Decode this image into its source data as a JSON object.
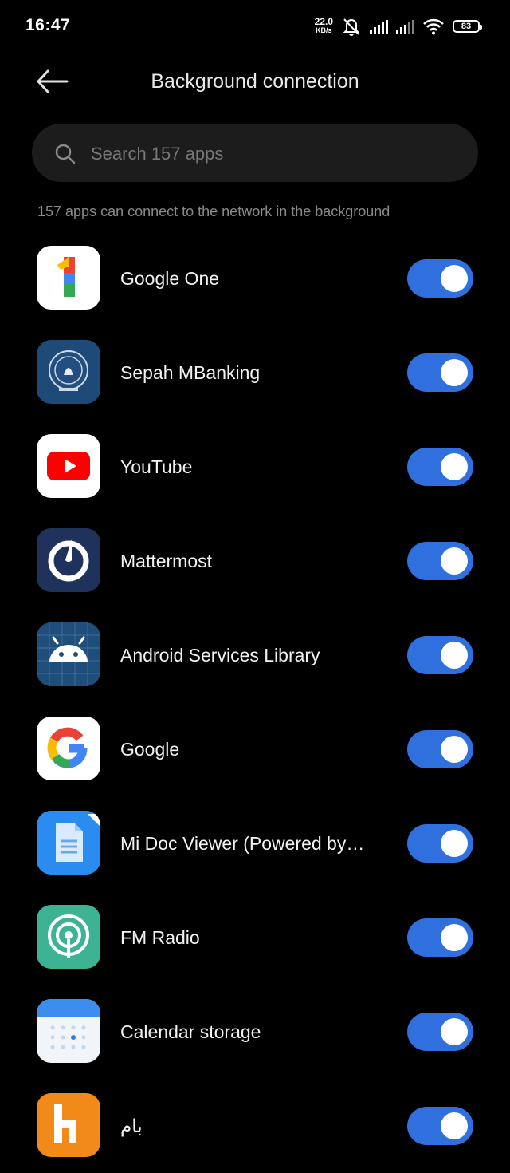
{
  "status_bar": {
    "time": "16:47",
    "net_speed_value": "22.0",
    "net_speed_unit": "KB/s",
    "battery": "83",
    "icons": [
      "mute-bell-icon",
      "signal-icon",
      "signal-icon",
      "wifi-icon",
      "battery-icon"
    ]
  },
  "header": {
    "title": "Background connection",
    "back_icon": "back-arrow-icon"
  },
  "search": {
    "placeholder": "Search 157 apps",
    "value": ""
  },
  "subtitle": "157 apps can connect to the network in the background",
  "accent_color": "#2f6fde",
  "apps": [
    {
      "name": "Google One",
      "enabled": true,
      "icon": "google-one-icon"
    },
    {
      "name": "Sepah MBanking",
      "enabled": true,
      "icon": "sepah-bank-icon"
    },
    {
      "name": "YouTube",
      "enabled": true,
      "icon": "youtube-icon"
    },
    {
      "name": "Mattermost",
      "enabled": true,
      "icon": "mattermost-icon"
    },
    {
      "name": "Android Services Library",
      "enabled": true,
      "icon": "android-icon"
    },
    {
      "name": "Google",
      "enabled": true,
      "icon": "google-g-icon"
    },
    {
      "name": "Mi Doc Viewer (Powered by…",
      "enabled": true,
      "icon": "mi-doc-viewer-icon"
    },
    {
      "name": "FM Radio",
      "enabled": true,
      "icon": "fm-radio-icon"
    },
    {
      "name": "Calendar storage",
      "enabled": true,
      "icon": "calendar-storage-icon"
    },
    {
      "name": "بام",
      "enabled": true,
      "icon": "bam-icon"
    }
  ]
}
